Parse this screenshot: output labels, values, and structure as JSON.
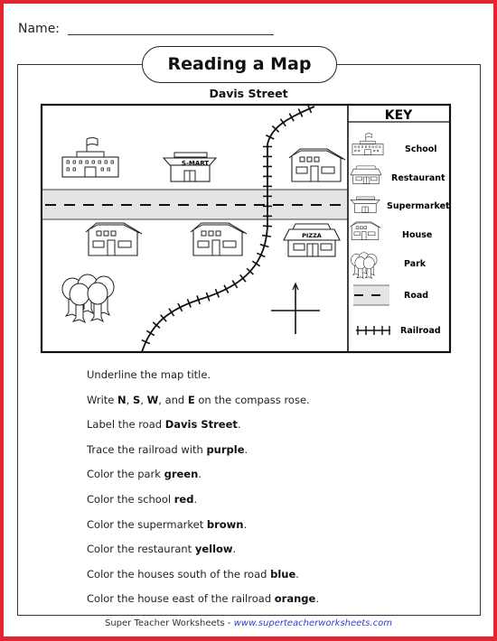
{
  "header": {
    "name_label": "Name:"
  },
  "title": "Reading a Map",
  "map": {
    "title": "Davis Street",
    "labels": {
      "supermarket_sign": "S-MART",
      "restaurant_sign": "PIZZA"
    },
    "features": [
      "school",
      "supermarket",
      "house",
      "house",
      "house",
      "restaurant",
      "park",
      "road",
      "railroad",
      "compass-rose"
    ]
  },
  "key": {
    "title": "KEY",
    "items": [
      {
        "icon": "school-icon",
        "label": "School"
      },
      {
        "icon": "restaurant-icon",
        "label": "Restaurant"
      },
      {
        "icon": "supermarket-icon",
        "label": "Supermarket"
      },
      {
        "icon": "house-icon",
        "label": "House"
      },
      {
        "icon": "park-icon",
        "label": "Park"
      },
      {
        "icon": "road-icon",
        "label": "Road"
      },
      {
        "icon": "railroad-icon",
        "label": "Railroad"
      }
    ]
  },
  "instructions": [
    {
      "parts": [
        {
          "t": "Underline the map title.",
          "b": false
        }
      ]
    },
    {
      "parts": [
        {
          "t": "Write ",
          "b": false
        },
        {
          "t": "N",
          "b": true
        },
        {
          "t": ", ",
          "b": false
        },
        {
          "t": "S",
          "b": true
        },
        {
          "t": ", ",
          "b": false
        },
        {
          "t": "W",
          "b": true
        },
        {
          "t": ", and ",
          "b": false
        },
        {
          "t": "E",
          "b": true
        },
        {
          "t": " on the compass rose.",
          "b": false
        }
      ]
    },
    {
      "parts": [
        {
          "t": "Label the road ",
          "b": false
        },
        {
          "t": "Davis Street",
          "b": true
        },
        {
          "t": ".",
          "b": false
        }
      ]
    },
    {
      "parts": [
        {
          "t": "Trace the railroad with ",
          "b": false
        },
        {
          "t": "purple",
          "b": true
        },
        {
          "t": ".",
          "b": false
        }
      ]
    },
    {
      "parts": [
        {
          "t": "Color the park ",
          "b": false
        },
        {
          "t": "green",
          "b": true
        },
        {
          "t": ".",
          "b": false
        }
      ]
    },
    {
      "parts": [
        {
          "t": "Color the school ",
          "b": false
        },
        {
          "t": "red",
          "b": true
        },
        {
          "t": ".",
          "b": false
        }
      ]
    },
    {
      "parts": [
        {
          "t": "Color the supermarket ",
          "b": false
        },
        {
          "t": "brown",
          "b": true
        },
        {
          "t": ".",
          "b": false
        }
      ]
    },
    {
      "parts": [
        {
          "t": "Color the restaurant ",
          "b": false
        },
        {
          "t": "yellow",
          "b": true
        },
        {
          "t": ".",
          "b": false
        }
      ]
    },
    {
      "parts": [
        {
          "t": "Color the houses south of the road ",
          "b": false
        },
        {
          "t": "blue",
          "b": true
        },
        {
          "t": ".",
          "b": false
        }
      ]
    },
    {
      "parts": [
        {
          "t": "Color the house east of the railroad ",
          "b": false
        },
        {
          "t": "orange",
          "b": true
        },
        {
          "t": ".",
          "b": false
        }
      ]
    }
  ],
  "footer": {
    "brand": "Super Teacher Worksheets - ",
    "url": "www.superteacherworksheets.com"
  },
  "colors": {
    "frame": "#e2252f",
    "road": "#e4e4e4",
    "link": "#3b3bd0"
  }
}
